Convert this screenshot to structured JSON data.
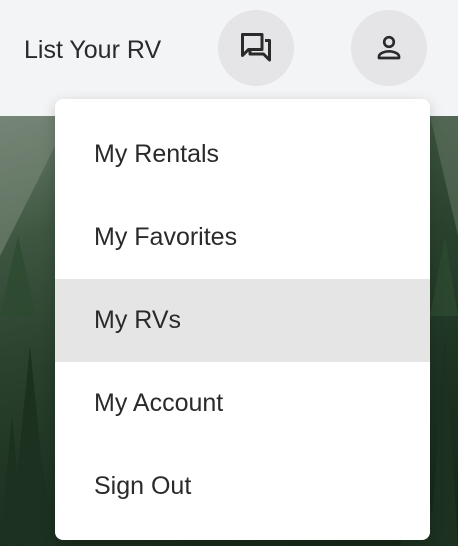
{
  "header": {
    "list_rv_label": "List Your RV",
    "messages_icon": "chat-bubbles-icon",
    "profile_icon": "user-icon"
  },
  "menu": {
    "items": [
      {
        "label": "My Rentals",
        "active": false
      },
      {
        "label": "My Favorites",
        "active": false
      },
      {
        "label": "My RVs",
        "active": true
      },
      {
        "label": "My Account",
        "active": false
      },
      {
        "label": "Sign Out",
        "active": false
      }
    ]
  },
  "colors": {
    "header_bg": "#f3f4f6",
    "icon_button_bg": "#e5e5e8",
    "menu_bg": "#ffffff",
    "menu_active_bg": "#e5e5e5",
    "text": "#2a2a2a"
  }
}
